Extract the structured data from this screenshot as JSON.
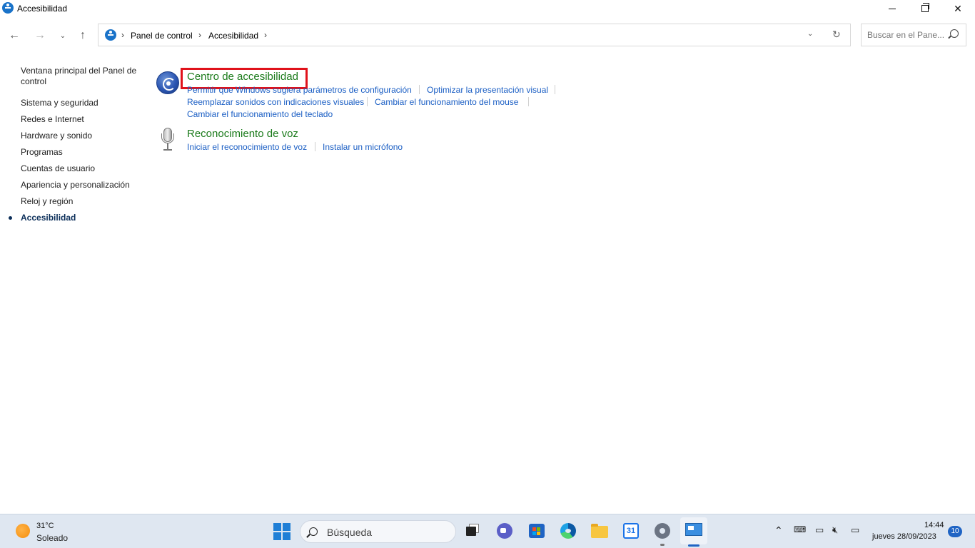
{
  "window": {
    "title": "Accesibilidad"
  },
  "address_bar": {
    "breadcrumbs": [
      "Panel de control",
      "Accesibilidad"
    ],
    "search_placeholder": "Buscar en el Pane..."
  },
  "left_nav": {
    "items": [
      {
        "label": "Ventana principal del Panel de control",
        "current": false
      },
      {
        "label": "Sistema y seguridad",
        "current": false
      },
      {
        "label": "Redes e Internet",
        "current": false
      },
      {
        "label": "Hardware y sonido",
        "current": false
      },
      {
        "label": "Programas",
        "current": false
      },
      {
        "label": "Cuentas de usuario",
        "current": false
      },
      {
        "label": "Apariencia y personalización",
        "current": false
      },
      {
        "label": "Reloj y región",
        "current": false
      },
      {
        "label": "Accesibilidad",
        "current": true
      }
    ]
  },
  "categories": [
    {
      "title": "Centro de accesibilidad",
      "icon": "ease-of-access-icon",
      "highlighted": true,
      "tasks": [
        "Permitir que Windows sugiera parámetros de configuración",
        "Optimizar la presentación visual",
        "Reemplazar sonidos con indicaciones visuales",
        "Cambiar el funcionamiento del mouse",
        "Cambiar el funcionamiento del teclado"
      ]
    },
    {
      "title": "Reconocimiento de voz",
      "icon": "microphone-icon",
      "highlighted": false,
      "tasks": [
        "Iniciar el reconocimiento de voz",
        "Instalar un micrófono"
      ]
    }
  ],
  "taskbar": {
    "weather": {
      "temp": "31°C",
      "condition": "Soleado"
    },
    "search_label": "Búsqueda",
    "calendar_day": "31",
    "clock": {
      "time": "14:44",
      "date": "jueves 28/09/2023"
    },
    "notification_count": "10"
  },
  "colors": {
    "category_title": "#1a7a1a",
    "task_link": "#1a5ec4",
    "highlight_box": "#e0121b",
    "taskbar_bg": "#dfe7f1"
  }
}
